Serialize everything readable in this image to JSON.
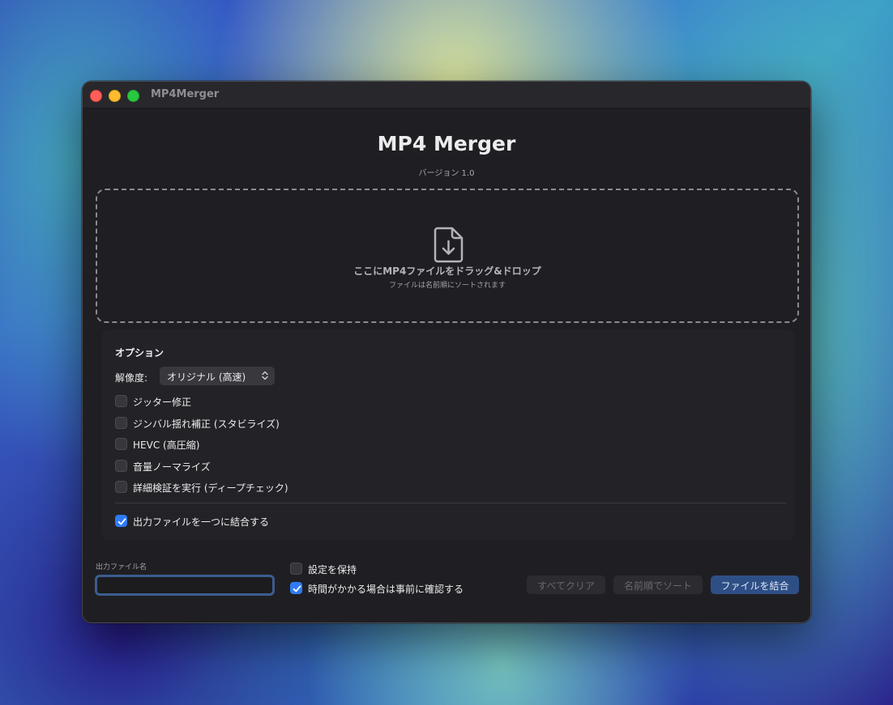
{
  "window": {
    "title": "MP4Merger"
  },
  "header": {
    "title": "MP4 Merger",
    "version": "バージョン 1.0"
  },
  "dropzone": {
    "icon": "document-download-icon",
    "main_text": "ここにMP4ファイルをドラッグ&ドロップ",
    "sub_text": "ファイルは名前順にソートされます"
  },
  "options": {
    "title": "オプション",
    "resolution_label": "解像度:",
    "resolution_value": "オリジナル (高速)",
    "checkboxes": [
      {
        "label": "ジッター修正",
        "checked": false
      },
      {
        "label": "ジンバル揺れ補正 (スタビライズ)",
        "checked": false
      },
      {
        "label": "HEVC (高圧縮)",
        "checked": false
      },
      {
        "label": "音量ノーマライズ",
        "checked": false
      },
      {
        "label": "詳細検証を実行 (ディープチェック)",
        "checked": false
      }
    ],
    "combine": {
      "label": "出力ファイルを一つに結合する",
      "checked": true
    }
  },
  "footer": {
    "output_label": "出力ファイル名",
    "output_value": "",
    "keep_settings": {
      "label": "設定を保持",
      "checked": false
    },
    "confirm_long": {
      "label": "時間がかかる場合は事前に確認する",
      "checked": true
    },
    "clear_button": "すべてクリア",
    "sort_button": "名前順でソート",
    "merge_button": "ファイルを結合"
  },
  "colors": {
    "accent": "#2f7bf5",
    "window_bg": "#1f1f23",
    "primary_button": "#2e4f86"
  }
}
